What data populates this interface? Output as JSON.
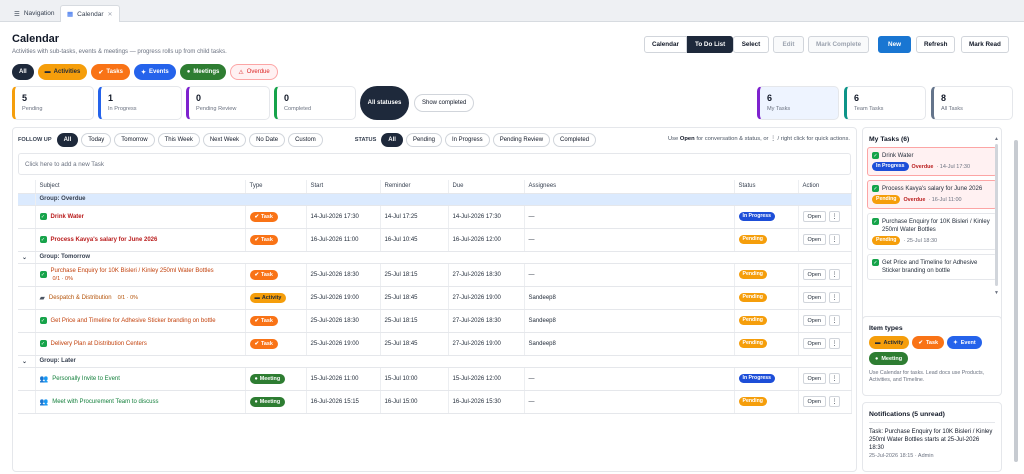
{
  "tabs": [
    {
      "label": "Navigation",
      "icon": "menu-icon"
    },
    {
      "label": "Calendar",
      "icon": "calendar-icon"
    }
  ],
  "header": {
    "title": "Calendar",
    "subtitle": "Activities with sub-tasks, events & meetings — progress rolls up from child tasks."
  },
  "type_filters": {
    "all": "All",
    "activities": "Activities",
    "tasks": "Tasks",
    "events": "Events",
    "meetings": "Meetings",
    "overdue": "Overdue"
  },
  "toolbar": {
    "calendar": "Calendar",
    "todo": "To Do List",
    "select": "Select",
    "edit": "Edit",
    "mark_complete": "Mark Complete",
    "new": "New",
    "refresh": "Refresh",
    "mark_read": "Mark Read"
  },
  "stats": {
    "pending": {
      "num": "5",
      "label": "Pending"
    },
    "in_progress": {
      "num": "1",
      "label": "In Progress"
    },
    "pending_review": {
      "num": "0",
      "label": "Pending Review"
    },
    "completed": {
      "num": "0",
      "label": "Completed"
    },
    "all_statuses": "All statuses",
    "show_completed": "Show completed",
    "my_tasks": {
      "num": "6",
      "label": "My Tasks"
    },
    "team_tasks": {
      "num": "6",
      "label": "Team Tasks"
    },
    "all_tasks": {
      "num": "8",
      "label": "All Tasks"
    }
  },
  "follow_up": {
    "label": "FOLLOW UP",
    "options": [
      "All",
      "Today",
      "Tomorrow",
      "This Week",
      "Next Week",
      "No Date",
      "Custom"
    ]
  },
  "status_filter": {
    "label": "STATUS",
    "options": [
      "All",
      "Pending",
      "In Progress",
      "Pending Review",
      "Completed"
    ]
  },
  "hint": {
    "pre": "Use ",
    "bold": "Open",
    "post": " for conversation & status, or ⋮ / right click for quick actions."
  },
  "add_task_placeholder": "Click here to add a new Task",
  "table": {
    "columns": [
      "Subject",
      "Type",
      "Start",
      "Reminder",
      "Due",
      "Assignees",
      "Status",
      "Action"
    ],
    "open_label": "Open",
    "groups": [
      {
        "label": "Group: Overdue",
        "rows": [
          {
            "subject": "Drink Water",
            "type": "Task",
            "start": "14-Jul-2026 17:30",
            "reminder": "14-Jul 17:25",
            "due": "14-Jul-2026 17:30",
            "assignees": "—",
            "status": "In Progress"
          },
          {
            "subject": "Process Kavya's salary for June 2026",
            "type": "Task",
            "start": "16-Jul-2026 11:00",
            "reminder": "16-Jul 10:45",
            "due": "16-Jul-2026 12:00",
            "assignees": "—",
            "status": "Pending"
          }
        ]
      },
      {
        "label": "Group: Tomorrow",
        "rows": [
          {
            "subject": "Purchase Enquiry for 10K Bisleri / Kinley 250ml Water Bottles",
            "meta": "0/1 · 0%",
            "type": "Task",
            "start": "25-Jul-2026 18:30",
            "reminder": "25-Jul 18:15",
            "due": "27-Jul-2026 18:30",
            "assignees": "—",
            "status": "Pending"
          },
          {
            "subject": "Despatch & Distribution",
            "meta": "0/1 · 0%",
            "type": "Activity",
            "start": "25-Jul-2026 19:00",
            "reminder": "25-Jul 18:45",
            "due": "27-Jul-2026 19:00",
            "assignees": "Sandeep8",
            "status": "Pending"
          },
          {
            "subject": "Get Price and Timeline for Adhesive Sticker branding on bottle",
            "type": "Task",
            "start": "25-Jul-2026 18:30",
            "reminder": "25-Jul 18:15",
            "due": "27-Jul-2026 18:30",
            "assignees": "Sandeep8",
            "status": "Pending"
          },
          {
            "subject": "Delivery Plan at Distribution Centers",
            "type": "Task",
            "start": "25-Jul-2026 19:00",
            "reminder": "25-Jul 18:45",
            "due": "27-Jul-2026 19:00",
            "assignees": "Sandeep8",
            "status": "Pending"
          }
        ]
      },
      {
        "label": "Group: Later",
        "rows": [
          {
            "subject": "Personally Invite to Event",
            "type": "Meeting",
            "start": "15-Jul-2026 11:00",
            "reminder": "15-Jul 10:00",
            "due": "15-Jul-2026 12:00",
            "assignees": "—",
            "status": "In Progress"
          },
          {
            "subject": "Meet with Procurement Team to discuss",
            "type": "Meeting",
            "start": "16-Jul-2026 15:15",
            "reminder": "16-Jul 15:00",
            "due": "16-Jul-2026 15:30",
            "assignees": "—",
            "status": "Pending"
          }
        ]
      }
    ]
  },
  "my_tasks": {
    "title": "My Tasks (6)",
    "items": [
      {
        "title": "Drink Water",
        "status": "In Progress",
        "overdue": "Overdue",
        "date": "· 14-Jul 17:30"
      },
      {
        "title": "Process Kavya's salary for June 2026",
        "status": "Pending",
        "overdue": "Overdue",
        "date": "· 16-Jul 11:00"
      },
      {
        "title": "Purchase Enquiry for 10K Bisleri / Kinley 250ml Water Bottles",
        "status": "Pending",
        "date": "· 25-Jul 18:30"
      },
      {
        "title": "Get Price and Timeline for Adhesive Sticker branding on bottle",
        "status": "",
        "date": ""
      }
    ]
  },
  "item_types": {
    "title": "Item types",
    "activity": "Activity",
    "task": "Task",
    "event": "Event",
    "meeting": "Meeting",
    "note": "Use Calendar for tasks. Lead docs use Products, Activities, and Timeline."
  },
  "notifications": {
    "title": "Notifications (5 unread)",
    "item": "Task: Purchase Enquiry for 10K Bisleri / Kinley 250ml Water Bottles starts at 25-Jul-2026 18:30",
    "meta": "25-Jul-2026 18:15 · Admin"
  }
}
